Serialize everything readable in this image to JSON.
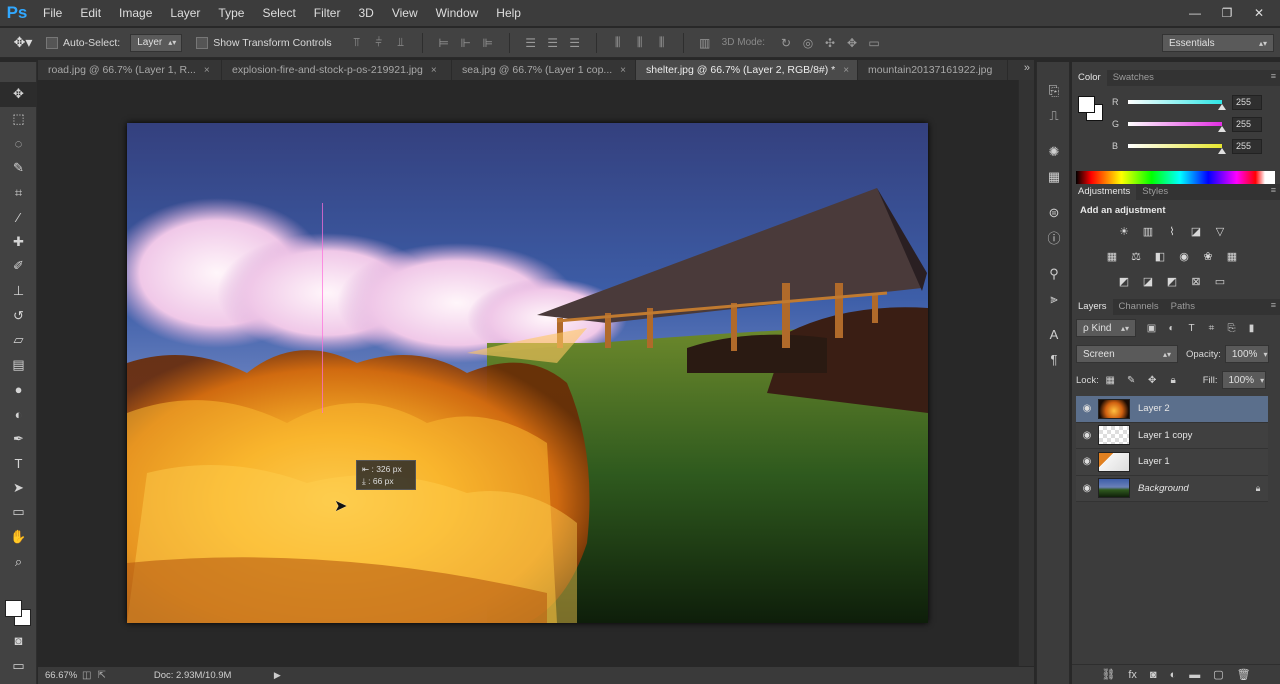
{
  "app": {
    "logo": "Ps",
    "menu": [
      "File",
      "Edit",
      "Image",
      "Layer",
      "Type",
      "Select",
      "Filter",
      "3D",
      "View",
      "Window",
      "Help"
    ],
    "window_controls": [
      "—",
      "❐",
      "✕"
    ]
  },
  "options_bar": {
    "auto_select_label": "Auto-Select:",
    "auto_select_value": "Layer",
    "show_transform_label": "Show Transform Controls",
    "mode_3d_label": "3D Mode:",
    "workspace": "Essentials"
  },
  "tabs": [
    {
      "label": "road.jpg @ 66.7% (Layer 1, R...",
      "active": false
    },
    {
      "label": "explosion-fire-and-stock-p-os-219921.jpg",
      "active": false
    },
    {
      "label": "sea.jpg @ 66.7% (Layer 1 cop...",
      "active": false
    },
    {
      "label": "shelter.jpg @ 66.7% (Layer 2, RGB/8#) *",
      "active": true
    },
    {
      "label": "mountain20137161922.jpg",
      "active": false
    }
  ],
  "tabs_more": "»",
  "canvas": {
    "measure_dx": "⇤ :  326 px",
    "measure_dy": "⤓ :    66 px"
  },
  "status": {
    "zoom": "66.67%",
    "doc_size": "Doc: 2.93M/10.9M",
    "arrow": "▶"
  },
  "color_panel": {
    "tabs": [
      "Color",
      "Swatches"
    ],
    "channels": [
      {
        "label": "R",
        "value": "255",
        "color": "#2ee6e6",
        "level": 1.0
      },
      {
        "label": "G",
        "value": "255",
        "color": "#e22ee2",
        "level": 1.0
      },
      {
        "label": "B",
        "value": "255",
        "color": "#e6e62e",
        "level": 1.0
      }
    ]
  },
  "adjustments_panel": {
    "tabs": [
      "Adjustments",
      "Styles"
    ],
    "title": "Add an adjustment"
  },
  "layers_panel": {
    "tabs": [
      "Layers",
      "Channels",
      "Paths"
    ],
    "filter_kind": "ρ Kind",
    "blend_mode": "Screen",
    "opacity_label": "Opacity:",
    "opacity_value": "100%",
    "lock_label": "Lock:",
    "fill_label": "Fill:",
    "fill_value": "100%",
    "layers": [
      {
        "name": "Layer 2",
        "selected": true,
        "italic": false,
        "locked": false
      },
      {
        "name": "Layer 1 copy",
        "selected": false,
        "italic": false,
        "locked": false
      },
      {
        "name": "Layer 1",
        "selected": false,
        "italic": false,
        "locked": false
      },
      {
        "name": "Background",
        "selected": false,
        "italic": true,
        "locked": true
      }
    ]
  },
  "colors": {
    "accent": "#31a8ff",
    "selected_layer": "#5b6f8c"
  }
}
